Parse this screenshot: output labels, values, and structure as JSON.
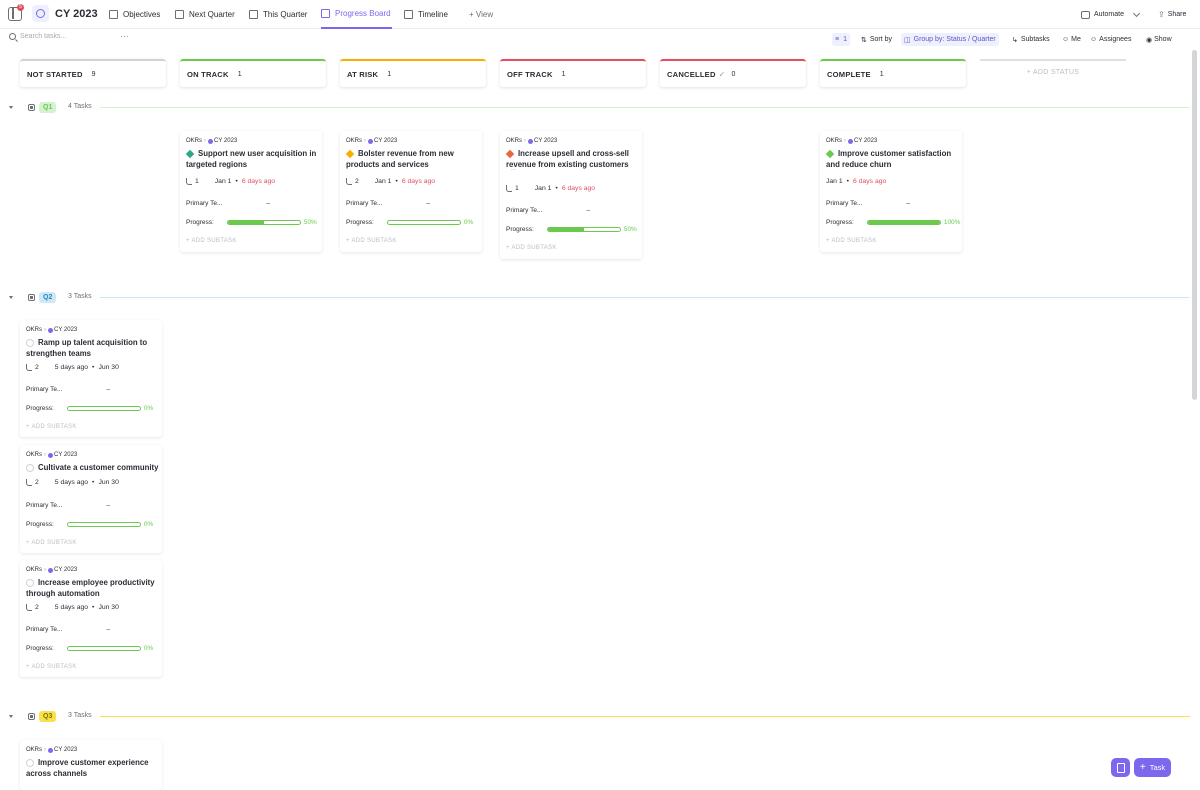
{
  "topbar": {
    "badge": "5",
    "title": "CY 2023",
    "tabs": [
      "Objectives",
      "Next Quarter",
      "This Quarter",
      "Progress Board",
      "Timeline"
    ],
    "add_view": "+ View",
    "automate": "Automate",
    "share": "Share"
  },
  "toolbar": {
    "search_placeholder": "Search tasks...",
    "dots": "···",
    "filter_count": "1",
    "sort": "Sort by",
    "group": "Group by: Status / Quarter",
    "subtasks": "Subtasks",
    "me": "Me",
    "assignees": "Assignees",
    "show": "Show"
  },
  "columns": [
    {
      "name": "NOT STARTED",
      "count": "9",
      "color": "#d3d3d3"
    },
    {
      "name": "ON TRACK",
      "count": "1",
      "color": "#6bc950"
    },
    {
      "name": "AT RISK",
      "count": "1",
      "color": "#f8ae00"
    },
    {
      "name": "OFF TRACK",
      "count": "1",
      "color": "#e04f5f"
    },
    {
      "name": "CANCELLED",
      "count": "0",
      "color": "#e04f5f"
    },
    {
      "name": "COMPLETE",
      "count": "1",
      "color": "#6bc950"
    }
  ],
  "add_status": "+ ADD STATUS",
  "groups": [
    {
      "label": "Q1",
      "count": "4 Tasks",
      "color": "#6bc950",
      "bg": "#d4f2cd"
    },
    {
      "label": "Q2",
      "count": "3 Tasks",
      "color": "#1e8bc3",
      "bg": "#d0e8f5"
    },
    {
      "label": "Q3",
      "count": "3 Tasks",
      "color": "#8a6d00",
      "bg": "#f8e14b"
    }
  ],
  "labels": {
    "okrs": "OKRs",
    "cy": "CY 2023",
    "primary": "Primary Te...",
    "dash": "–",
    "progress": "Progress:",
    "add_subtask": "+ ADD SUBTASK",
    "task_btn": "Task"
  },
  "cards": [
    {
      "title": "Support new user acquisition in targeted regions",
      "subs": "1",
      "start": "Jan 1",
      "due": "6 days ago",
      "progress": 50,
      "pct": "50%",
      "dm": "#2ea88b"
    },
    {
      "title": "Bolster revenue from new products and services",
      "subs": "2",
      "start": "Jan 1",
      "due": "6 days ago",
      "progress": 0,
      "pct": "0%",
      "dm": "#f8ae00"
    },
    {
      "title": "Increase upsell and cross-sell revenue from existing customers",
      "subs": "1",
      "start": "Jan 1",
      "due": "6 days ago",
      "progress": 50,
      "pct": "50%",
      "dm": "#e8663d",
      "extra": "..."
    },
    {
      "title": "Improve customer satisfaction and reduce churn",
      "start": "Jan 1",
      "due": "6 days ago",
      "progress": 100,
      "pct": "100%",
      "dm": "#6bc950"
    },
    {
      "title": "Ramp up talent acquisition to strengthen teams",
      "subs": "2",
      "start": "5 days ago",
      "due": "Jun 30",
      "progress": 0,
      "pct": "0%"
    },
    {
      "title": "Cultivate a customer community",
      "subs": "2",
      "start": "5 days ago",
      "due": "Jun 30",
      "progress": 0,
      "pct": "0%"
    },
    {
      "title": "Increase employee productivity through automation",
      "subs": "2",
      "start": "5 days ago",
      "due": "Jun 30",
      "progress": 0,
      "pct": "0%"
    },
    {
      "title": "Improve customer experience across channels"
    }
  ]
}
